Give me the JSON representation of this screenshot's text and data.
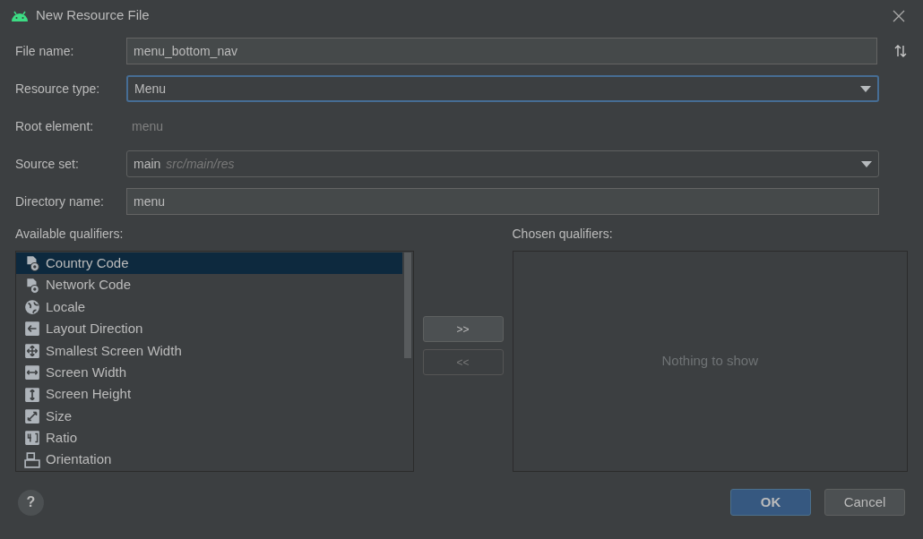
{
  "window": {
    "title": "New Resource File"
  },
  "form": [
    {
      "kind": "text",
      "label": "File name:",
      "value": "menu_bottom_nav",
      "focused": false
    },
    {
      "kind": "dropdown",
      "label": "Resource type:",
      "value": "Menu",
      "focused": true
    },
    {
      "kind": "plain",
      "label": "Root element:",
      "value": "menu"
    },
    {
      "kind": "dropdown",
      "label": "Source set:",
      "value": "main",
      "hint": "src/main/res",
      "focused": false
    },
    {
      "kind": "text",
      "label": "Directory name:",
      "value": "menu",
      "focused": false
    }
  ],
  "available_qualifiers": {
    "label": "Available qualifiers:",
    "items": [
      {
        "label": "Country Code",
        "kind": "sim-globe",
        "selected": true
      },
      {
        "label": "Network Code",
        "kind": "sim-signal",
        "selected": false
      },
      {
        "label": "Locale",
        "kind": "globe",
        "selected": false
      },
      {
        "label": "Layout Direction",
        "kind": "arrow-left",
        "selected": false
      },
      {
        "label": "Smallest Screen Width",
        "kind": "move",
        "selected": false
      },
      {
        "label": "Screen Width",
        "kind": "horizontal",
        "selected": false
      },
      {
        "label": "Screen Height",
        "kind": "vertical",
        "selected": false
      },
      {
        "label": "Size",
        "kind": "diagonal",
        "selected": false
      },
      {
        "label": "Ratio",
        "kind": "ratio",
        "selected": false
      },
      {
        "label": "Orientation",
        "kind": "orientation",
        "selected": false
      }
    ]
  },
  "transfer_buttons": [
    {
      "label": ">>",
      "disabled": false
    },
    {
      "label": "<<",
      "disabled": true
    }
  ],
  "chosen_qualifiers": {
    "label": "Chosen qualifiers:",
    "empty_text": "Nothing to show"
  },
  "help": "?",
  "buttons": [
    {
      "label": "OK",
      "primary": true
    },
    {
      "label": "Cancel",
      "primary": false
    }
  ]
}
